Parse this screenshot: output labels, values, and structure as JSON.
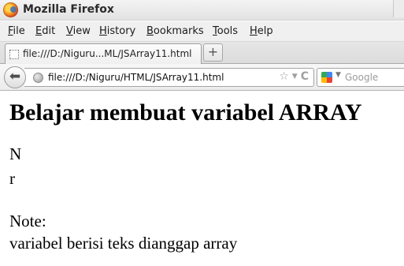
{
  "window": {
    "title": "Mozilla Firefox"
  },
  "menu": [
    {
      "underline": "F",
      "rest": "ile"
    },
    {
      "underline": "E",
      "rest": "dit"
    },
    {
      "underline": "V",
      "rest": "iew"
    },
    {
      "underline": "H",
      "rest": "istory",
      "prefix": ""
    },
    {
      "underline": "B",
      "rest": "ookmarks"
    },
    {
      "underline": "T",
      "rest": "ools"
    },
    {
      "underline": "H",
      "rest": "elp"
    }
  ],
  "tab": {
    "label": "file:///D:/Niguru...ML/JSArray11.html",
    "new_tab": "+"
  },
  "navigation": {
    "back": "⬅",
    "url": "file:///D:/Niguru/HTML/JSArray11.html",
    "bookmark_star": "☆",
    "dropdown": "▼",
    "reload": "C"
  },
  "search": {
    "placeholder": "Google",
    "caret": "▼"
  },
  "page": {
    "heading": "Belajar membuat variabel ARRAY",
    "lines": [
      "N",
      "r",
      "Note:",
      "variabel berisi teks dianggap array"
    ]
  }
}
